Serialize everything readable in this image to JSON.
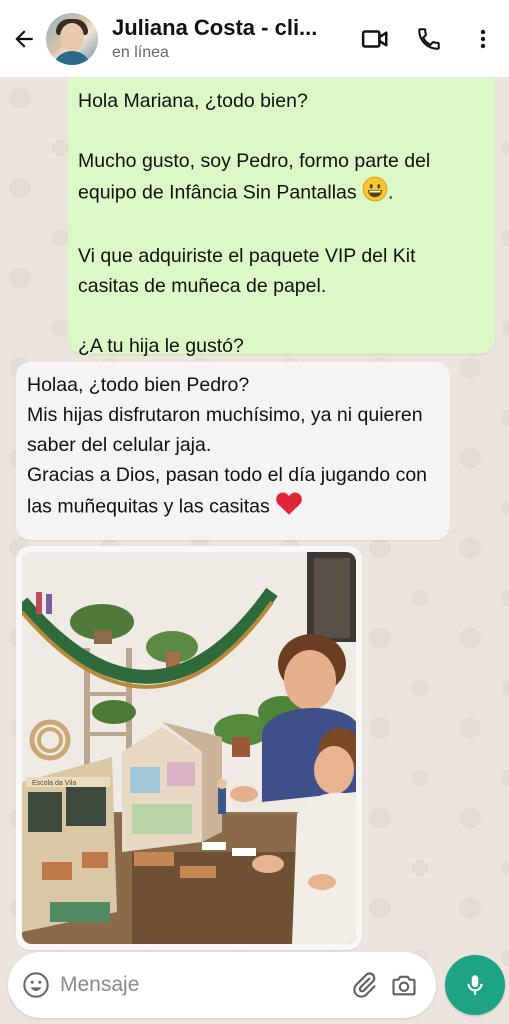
{
  "header": {
    "contact_name": "Juliana Costa - cli...",
    "status": "en línea",
    "icons": {
      "back": "back-arrow-icon",
      "video": "video-call-icon",
      "call": "phone-icon",
      "menu": "more-vert-icon"
    }
  },
  "messages": {
    "outgoing": {
      "line1": "Hola Mariana, ¿todo bien?",
      "line2": "Mucho gusto, soy Pedro, formo parte del equipo de Infância Sin Pantallas",
      "line2_emoji": "😀",
      "line2_end": ".",
      "line3": "Vi que adquiriste el paquete VIP del Kit casitas de muñeca de papel.",
      "line4": "¿A tu hija le gustó?"
    },
    "incoming": {
      "line1": "Holaa, ¿todo bien Pedro?",
      "line2": "Mis hijas disfrutaron muchísimo, ya ni quieren saber del celular jaja.",
      "line3": "Gracias a Dios, pasan todo el día jugando con las muñequitas y las casitas",
      "line3_emoji": "❤️"
    },
    "image": {
      "type": "photo",
      "board_text": "Escola da Vila"
    }
  },
  "composer": {
    "placeholder": "Mensaje",
    "icons": {
      "emoji": "emoji-icon",
      "attach": "paperclip-icon",
      "camera": "camera-icon",
      "mic": "mic-icon"
    }
  },
  "colors": {
    "outgoing_bubble": "#dcf8c6",
    "incoming_bubble": "#f4f4f4",
    "accent": "#1fa385"
  }
}
